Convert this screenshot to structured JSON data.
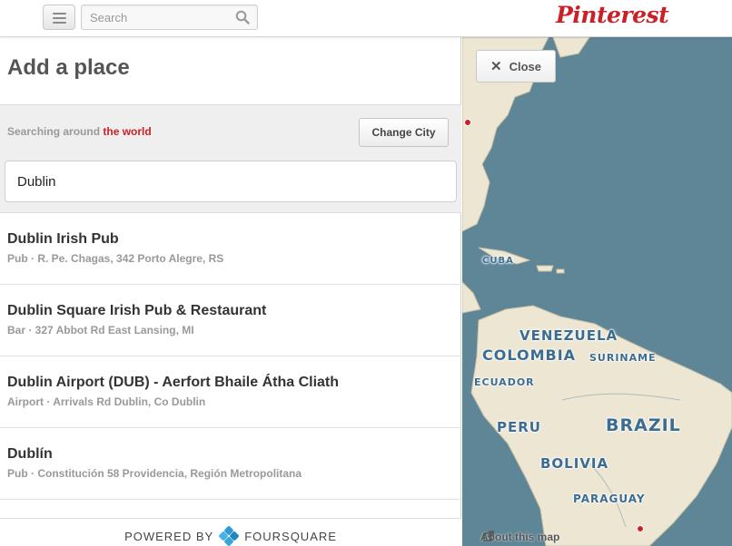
{
  "header": {
    "search_placeholder": "Search",
    "logo": "Pinterest",
    "menu_icon": "hamburger-menu-icon",
    "search_icon": "magnifier-icon"
  },
  "panel": {
    "title": "Add a place",
    "searching_prefix": "Searching around",
    "searching_location": "the world",
    "change_city_label": "Change City",
    "place_query": "Dublin"
  },
  "results": [
    {
      "name": "Dublin Irish Pub",
      "meta": "Pub · R. Pe. Chagas, 342 Porto Alegre, RS"
    },
    {
      "name": "Dublin Square Irish Pub & Restaurant",
      "meta": "Bar · 327 Abbot Rd East Lansing, MI"
    },
    {
      "name": "Dublin Airport (DUB) - Aerfort Bhaile Átha Cliath",
      "meta": "Airport · Arrivals Rd Dublin, Co Dublin"
    },
    {
      "name": "Dublín",
      "meta": "Pub · Constitución 58 Providencia, Región Metropolitana"
    }
  ],
  "footer": {
    "powered_by": "POWERED BY",
    "provider": "FOURSQUARE"
  },
  "map": {
    "close_label": "Close",
    "about_label": "About this map",
    "labels": {
      "cuba": "CUBA",
      "venezuela": "VENEZUELA",
      "colombia": "COLOMBIA",
      "suriname": "SURINAME",
      "ecuador": "ECUADOR",
      "peru": "PERU",
      "brazil": "BRAZIL",
      "bolivia": "BOLIVIA",
      "paraguay": "PARAGUAY"
    },
    "colors": {
      "ocean": "#5f8697",
      "land": "#ece6d2",
      "label": "#3d6c93",
      "pin": "#cb2027"
    }
  },
  "colors": {
    "brand": "#cb2027"
  }
}
